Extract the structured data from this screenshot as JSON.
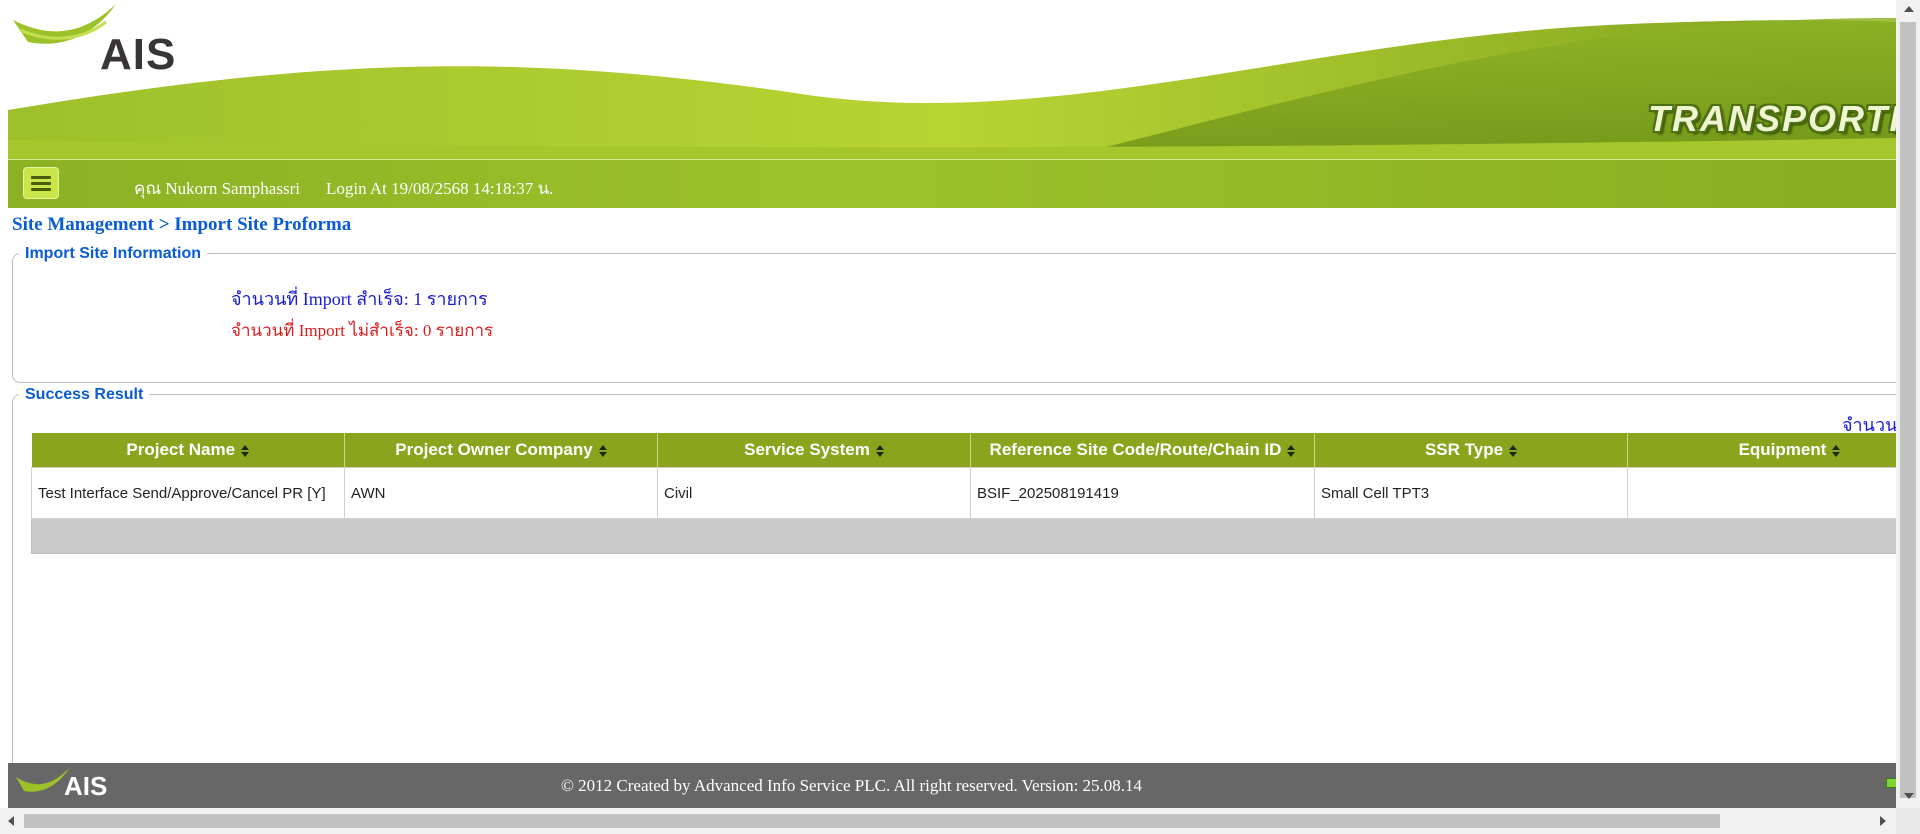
{
  "header": {
    "logo_text": "AIS",
    "banner_tag": "TRANSPORTI"
  },
  "userbar": {
    "user": "คุณ Nukorn Samphassri",
    "login": "Login At 19/08/2568 14:18:37 น."
  },
  "breadcrumb": "Site Management > Import Site Proforma",
  "import_info": {
    "legend": "Import Site Information",
    "success_count": "จำนวนที่ Import สำเร็จ: 1 รายการ",
    "fail_count": "จำนวนที่ Import ไม่สำเร็จ: 0 รายการ"
  },
  "success_result": {
    "legend": "Success Result",
    "right_label": "จำนวน",
    "columns": [
      "Project Name",
      "Project Owner Company",
      "Service System",
      "Reference Site Code/Route/Chain ID",
      "SSR Type",
      "Equipment"
    ],
    "rows": [
      [
        "Test Interface Send/Approve/Cancel PR [Y]",
        "AWN",
        "Civil",
        "BSIF_202508191419",
        "Small Cell TPT3",
        ""
      ]
    ]
  },
  "footer": {
    "logo_text": "AIS",
    "text": "© 2012 Created by Advanced Info Service PLC.  All right reserved.   Version: 25.08.14"
  },
  "colors": {
    "brand_green": "#8aa51d",
    "link_blue": "#0a5bd6",
    "error_red": "#e01b1b",
    "footer_gray": "#676767"
  },
  "icons": {
    "menu": "hamburger-menu-icon",
    "sort": "sort-arrows-icon"
  }
}
